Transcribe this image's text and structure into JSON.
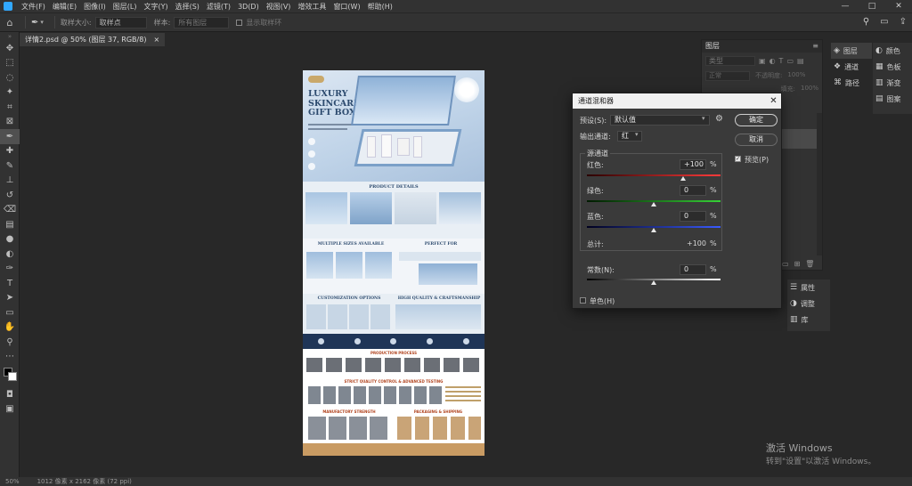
{
  "menu": {
    "items": [
      "文件(F)",
      "编辑(E)",
      "图像(I)",
      "图层(L)",
      "文字(Y)",
      "选择(S)",
      "滤镜(T)",
      "3D(D)",
      "视图(V)",
      "增效工具",
      "窗口(W)",
      "帮助(H)"
    ]
  },
  "window_controls": {
    "minimize": "—",
    "maximize": "□",
    "close": "✕"
  },
  "options": {
    "sample_size_label": "取样大小:",
    "sample_size_value": "取样点",
    "sample_label": "样本:",
    "sample_value": "所有图层",
    "show_ring": "显示取样环"
  },
  "document": {
    "tab_title": "详情2.psd @ 50% (图层 37, RGB/8)",
    "close": "×",
    "headline": "LUXURY SKINCARE GIFT BOX",
    "product_details": "PRODUCT DETAILS",
    "multiple_sizes": "MULTIPLE SIZES AVAILABLE",
    "perfect_for": "PERFECT FOR",
    "customization": "CUSTOMIZATION OPTIONS",
    "high_quality": "HIGH QUALITY & CRAFTSMANSHIP",
    "production_process": "PRODUCTION PROCESS",
    "strict_quality": "STRICT QUALITY CONTROL & ADVANCED TESTING",
    "manufactory": "MANUFACTORY STRENGTH",
    "packaging": "PACKAGING & SHIPPING"
  },
  "status": {
    "zoom": "50%",
    "size": "1012 像素 x 2162 像素 (72 ppi)"
  },
  "layers_panel": {
    "title": "图层",
    "search_placeholder": "类型",
    "blend_mode": "正常",
    "opacity_label": "不透明度:",
    "opacity_value": "100%",
    "fill_label": "填充:",
    "fill_value": "100%"
  },
  "dock": {
    "layers": "图层",
    "channels": "通道",
    "paths": "路径",
    "color": "颜色",
    "swatches": "色板",
    "gradients": "渐变",
    "patterns": "图案",
    "properties": "属性",
    "adjustments": "调整",
    "libraries": "库"
  },
  "dialog": {
    "title": "通道混和器",
    "preset_label": "预设(S):",
    "preset_value": "默认值",
    "output_label": "输出通道:",
    "output_value": "红",
    "source_group": "源通道",
    "red_label": "红色:",
    "red_value": "+100",
    "green_label": "绿色:",
    "green_value": "0",
    "blue_label": "蓝色:",
    "blue_value": "0",
    "total_label": "总计:",
    "total_value": "+100",
    "constant_label": "常数(N):",
    "constant_value": "0",
    "percent": "%",
    "monochrome": "单色(H)",
    "ok": "确定",
    "cancel": "取消",
    "preview": "预览(P)"
  },
  "watermark": {
    "line1": "激活 Windows",
    "line2": "转到\"设置\"以激活 Windows。"
  }
}
